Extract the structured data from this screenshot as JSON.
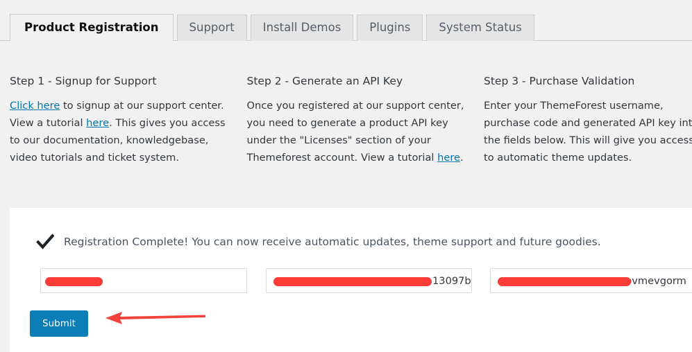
{
  "tabs": [
    {
      "label": "Product Registration",
      "active": true
    },
    {
      "label": "Support",
      "active": false
    },
    {
      "label": "Install Demos",
      "active": false
    },
    {
      "label": "Plugins",
      "active": false
    },
    {
      "label": "System Status",
      "active": false
    }
  ],
  "steps": [
    {
      "title": "Step 1 - Signup for Support",
      "link1": "Click here",
      "text1": " to signup at our support center. View a tutorial ",
      "link2": "here",
      "text2": ". This gives you access to our documentation, knowledgebase, video tutorials and ticket system."
    },
    {
      "title": "Step 2 - Generate an API Key",
      "text1": "Once you registered at our support center, you need to generate a product API key under the \"Licenses\" section of your Themeforest account. View a tutorial ",
      "link2": "here",
      "text2": "."
    },
    {
      "title": "Step 3 - Purchase Validation",
      "text1": "Enter your ThemeForest username, purchase code and generated API key into the fields below. This will give you access to automatic theme updates."
    }
  ],
  "panel": {
    "status_icon": "check-icon",
    "status_text": "Registration Complete! You can now receive automatic updates, theme support and future goodies.",
    "fields": [
      {
        "name": "username-field",
        "value": "",
        "redacted": true
      },
      {
        "name": "purchase-code-field",
        "value": "13097b",
        "redacted": true
      },
      {
        "name": "api-key-field",
        "value": "pvmevgorm",
        "redacted": true
      }
    ],
    "submit_label": "Submit"
  },
  "annotation": {
    "arrow": "left-arrow-annotation"
  },
  "colors": {
    "accent_blue": "#0b7eb8",
    "link_blue": "#0073aa",
    "redaction_red": "#fb3b35",
    "page_background": "#f1f1f1",
    "panel_background": "#ffffff"
  }
}
